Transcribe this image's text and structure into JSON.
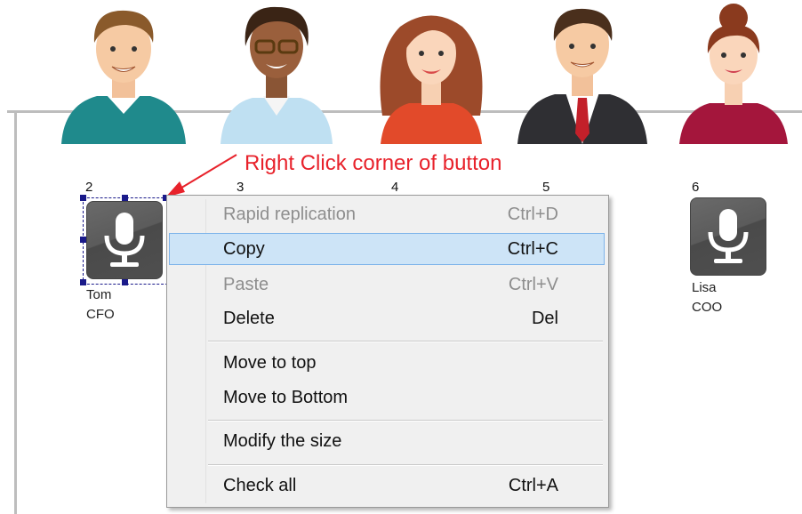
{
  "callout": {
    "text": "Right Click corner of button"
  },
  "avatars": [
    "man-teal-sweater-avatar",
    "woman-glasses-avatar",
    "woman-red-hair-avatar",
    "man-suit-avatar",
    "woman-bun-avatar"
  ],
  "buttons": [
    {
      "number": "2",
      "name": "Tom",
      "role": "CFO",
      "icon": "microphone-icon"
    },
    {
      "number": "3"
    },
    {
      "number": "4"
    },
    {
      "number": "5"
    },
    {
      "number": "6",
      "name": "Lisa",
      "role": "COO",
      "icon": "microphone-icon"
    }
  ],
  "context_menu": {
    "items": [
      {
        "label": "Rapid replication",
        "shortcut": "Ctrl+D",
        "disabled": true
      },
      {
        "label": "Copy",
        "shortcut": "Ctrl+C",
        "highlighted": true
      },
      {
        "label": "Paste",
        "shortcut": "Ctrl+V",
        "disabled": true
      },
      {
        "label": "Delete",
        "shortcut": "Del"
      },
      {
        "label": "Move to top",
        "shortcut": ""
      },
      {
        "label": "Move to Bottom",
        "shortcut": ""
      },
      {
        "label": "Modify the size",
        "shortcut": ""
      },
      {
        "label": "Check all",
        "shortcut": "Ctrl+A"
      }
    ]
  },
  "colors": {
    "callout": "#e8222b",
    "highlight": "#cde4f7",
    "highlight_border": "#7eb4ea",
    "selection_handle": "#1a1a8a"
  }
}
